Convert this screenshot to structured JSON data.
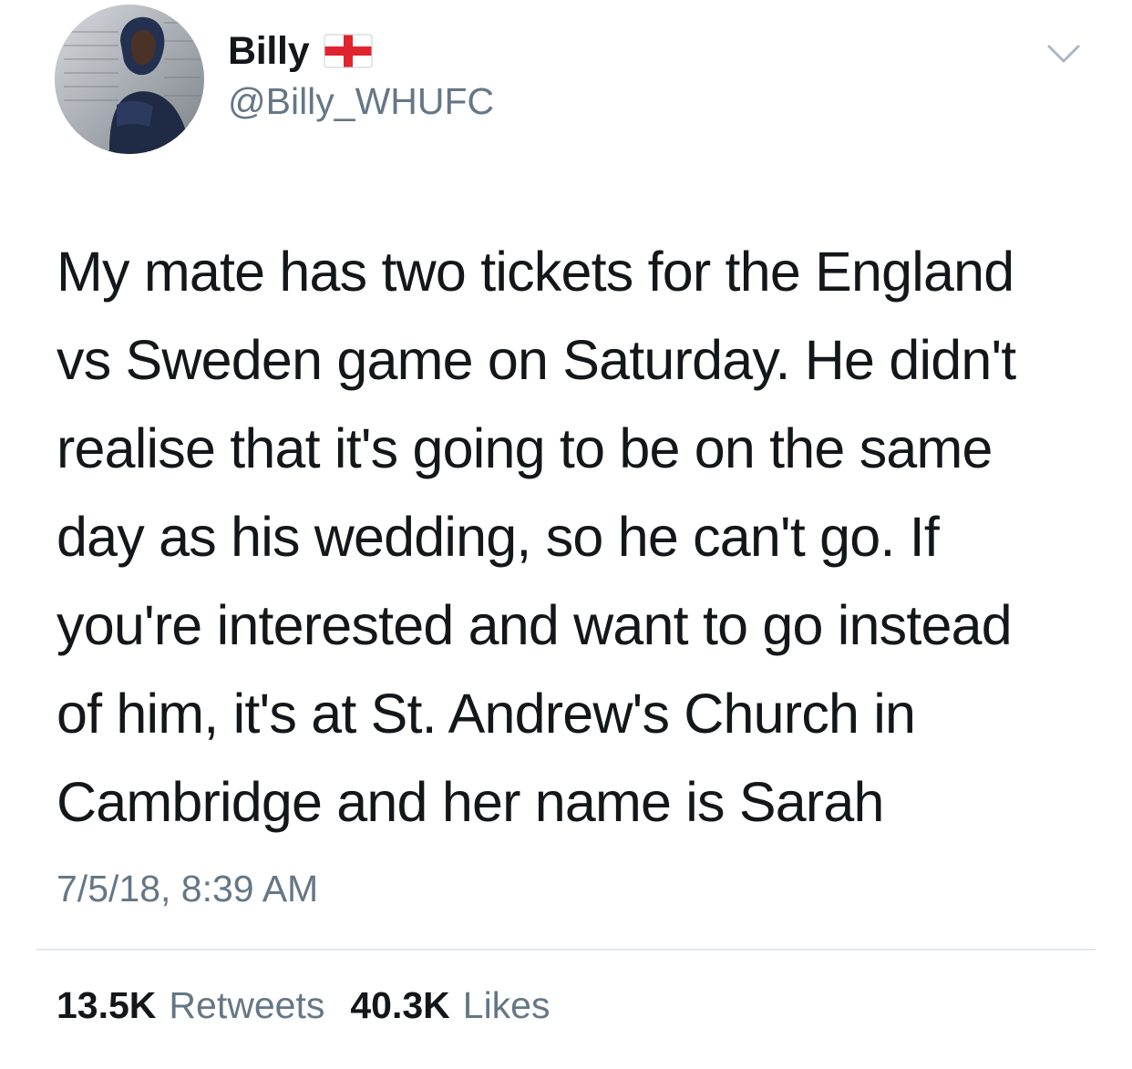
{
  "author": {
    "display_name": "Billy",
    "flag_icon": "england-flag-icon",
    "handle": "@Billy_WHUFC",
    "avatar_icon": "profile-photo"
  },
  "menu": {
    "icon": "chevron-down-icon"
  },
  "tweet": {
    "lines": [
      "My mate has two tickets for the England",
      "vs Sweden game on Saturday. He didn't",
      "realise that it's going to be on the same",
      "day as his wedding, so he can't go. If",
      "you're interested and want to go instead",
      "of him, it's at St. Andrew's Church in",
      "Cambridge and her name is Sarah"
    ],
    "timestamp": "7/5/18, 8:39 AM"
  },
  "stats": {
    "retweets_count": "13.5K",
    "retweets_label": "Retweets",
    "likes_count": "40.3K",
    "likes_label": "Likes"
  },
  "colors": {
    "text": "#14171a",
    "secondary": "#657786",
    "divider": "#e1e8ed",
    "flag_red": "#e0242f"
  }
}
